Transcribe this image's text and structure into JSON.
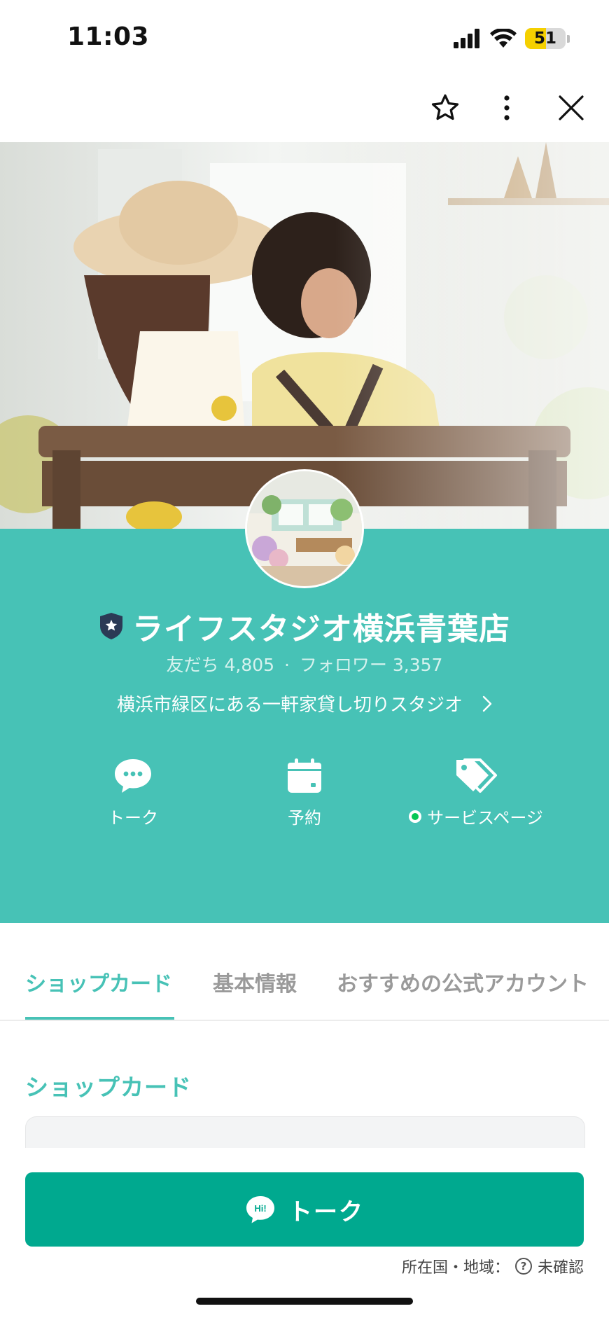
{
  "status_bar": {
    "time": "11:03",
    "battery": "51",
    "battery_level": 0.51
  },
  "toolbar": {
    "icons": [
      "star-icon",
      "more-vertical-icon",
      "close-icon"
    ]
  },
  "profile": {
    "badge_icon": "shield-star-icon",
    "name": "ライフスタジオ横浜青葉店",
    "friends_label": "友だち",
    "friends_count": "4,805",
    "separator": "·",
    "followers_label": "フォロワー",
    "followers_count": "3,357",
    "description": "横浜市緑区にある一軒家貸し切りスタジオ"
  },
  "actions": [
    {
      "label": "トーク",
      "icon": "chat-bubble-icon"
    },
    {
      "label": "予約",
      "icon": "calendar-icon"
    },
    {
      "label": "サービスページ",
      "icon": "tags-icon"
    }
  ],
  "tabs": [
    {
      "label": "ショップカード",
      "active": true
    },
    {
      "label": "基本情報",
      "active": false
    },
    {
      "label": "おすすめの公式アカウント",
      "active": false
    }
  ],
  "section": {
    "title": "ショップカード"
  },
  "bottom": {
    "talk_button_label": "トーク",
    "talk_badge": "Hi!",
    "region_label": "所在国・地域：",
    "region_help": "?",
    "region_value": "未確認"
  },
  "colors": {
    "teal": "#47c2b6",
    "talk_green": "#00a98f",
    "line_green": "#06c755"
  }
}
